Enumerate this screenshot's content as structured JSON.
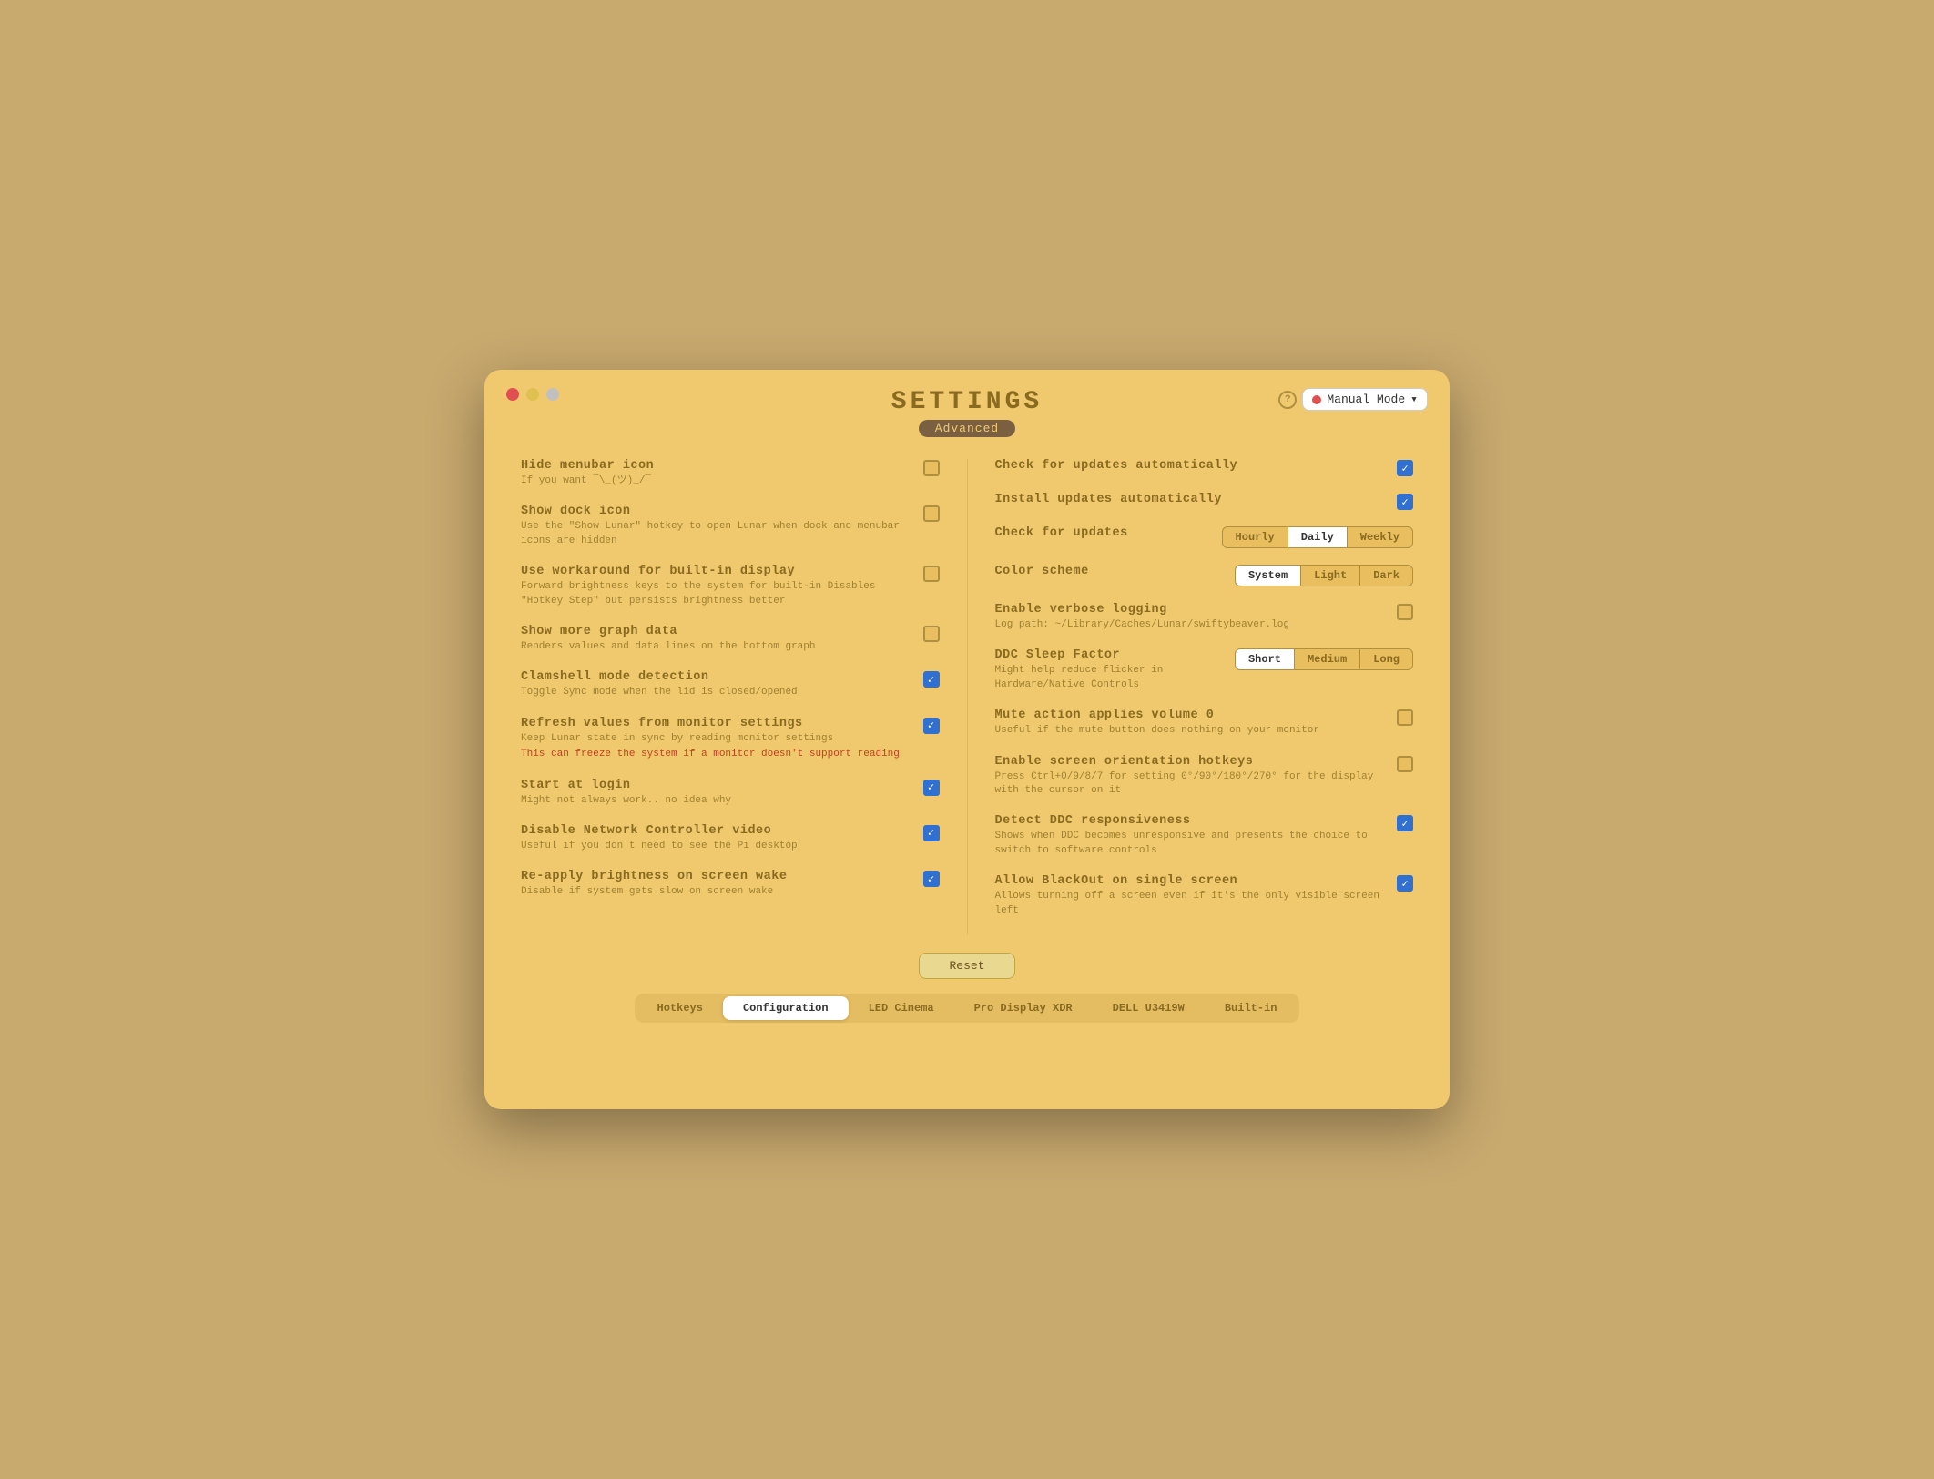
{
  "window": {
    "title": "SETTINGS",
    "subtitle": "Advanced"
  },
  "mode": {
    "label": "Manual Mode",
    "dot_color": "#e05050"
  },
  "left_settings": [
    {
      "id": "hide-menubar-icon",
      "label": "Hide menubar icon",
      "desc": "If you want ¯\\_(ツ)_/¯",
      "checked": false,
      "warning": false
    },
    {
      "id": "show-dock-icon",
      "label": "Show dock icon",
      "desc": "Use the \"Show Lunar\" hotkey to open Lunar\nwhen dock and menubar icons are hidden",
      "checked": false,
      "warning": false
    },
    {
      "id": "workaround-builtin",
      "label": "Use workaround for built-in display",
      "desc": "Forward brightness keys to the system for built-in\nDisables \"Hotkey Step\" but persists brightness better",
      "checked": false,
      "warning": false
    },
    {
      "id": "show-more-graph",
      "label": "Show more graph data",
      "desc": "Renders values and data lines on the bottom graph",
      "checked": false,
      "warning": false
    },
    {
      "id": "clamshell-mode",
      "label": "Clamshell mode detection",
      "desc": "Toggle Sync mode when the lid is closed/opened",
      "checked": true,
      "warning": false
    },
    {
      "id": "refresh-monitor",
      "label": "Refresh values from monitor settings",
      "desc": "Keep Lunar state in sync by reading monitor settings",
      "desc2": "This can freeze the system if a monitor doesn't support reading",
      "checked": true,
      "warning": true
    },
    {
      "id": "start-login",
      "label": "Start at login",
      "desc": "Might not always work.. no idea why",
      "checked": true,
      "warning": false
    },
    {
      "id": "disable-network",
      "label": "Disable Network Controller video",
      "desc": "Useful if you don't need to see the Pi desktop",
      "checked": true,
      "warning": false
    },
    {
      "id": "reapply-brightness",
      "label": "Re-apply brightness on screen wake",
      "desc": "Disable if system gets slow on screen wake",
      "checked": true,
      "warning": false
    }
  ],
  "right_settings": [
    {
      "id": "check-updates-auto",
      "label": "Check for updates automatically",
      "type": "checkbox",
      "checked": true
    },
    {
      "id": "install-updates-auto",
      "label": "Install updates automatically",
      "type": "checkbox",
      "checked": true
    },
    {
      "id": "check-updates-freq",
      "label": "Check for updates",
      "type": "button-group",
      "options": [
        "Hourly",
        "Daily",
        "Weekly"
      ],
      "active": "Daily"
    },
    {
      "id": "color-scheme",
      "label": "Color scheme",
      "type": "button-group",
      "options": [
        "System",
        "Light",
        "Dark"
      ],
      "active": "System"
    },
    {
      "id": "verbose-logging",
      "label": "Enable verbose logging",
      "desc": "Log path: ~/Library/Caches/Lunar/swiftybeaver.log",
      "type": "checkbox",
      "checked": false
    },
    {
      "id": "ddc-sleep-factor",
      "label": "DDC Sleep Factor",
      "desc": "Might help reduce flicker in Hardware/Native Controls",
      "type": "button-group",
      "options": [
        "Short",
        "Medium",
        "Long"
      ],
      "active": "Short"
    },
    {
      "id": "mute-volume",
      "label": "Mute action applies volume 0",
      "desc": "Useful if the mute button does nothing on\nyour monitor",
      "type": "checkbox",
      "checked": false
    },
    {
      "id": "screen-orientation",
      "label": "Enable screen orientation hotkeys",
      "desc": "Press Ctrl+0/9/8/7 for setting 0°/90°/180°/270° for\nthe display with the cursor on it",
      "type": "checkbox",
      "checked": false
    },
    {
      "id": "detect-ddc",
      "label": "Detect DDC responsiveness",
      "desc": "Shows when DDC becomes unresponsive and presents\nthe choice to switch to software controls",
      "type": "checkbox",
      "checked": true
    },
    {
      "id": "allow-blackout",
      "label": "Allow BlackOut on single screen",
      "desc": "Allows turning off a screen even if it's the only\nvisible screen left",
      "type": "checkbox",
      "checked": true
    }
  ],
  "reset_label": "Reset",
  "tabs": [
    {
      "id": "hotkeys",
      "label": "Hotkeys",
      "active": false
    },
    {
      "id": "configuration",
      "label": "Configuration",
      "active": true
    },
    {
      "id": "led-cinema",
      "label": "LED Cinema",
      "active": false
    },
    {
      "id": "pro-display-xdr",
      "label": "Pro Display XDR",
      "active": false
    },
    {
      "id": "dell-u3419w",
      "label": "DELL U3419W",
      "active": false
    },
    {
      "id": "built-in",
      "label": "Built-in",
      "active": false
    }
  ]
}
